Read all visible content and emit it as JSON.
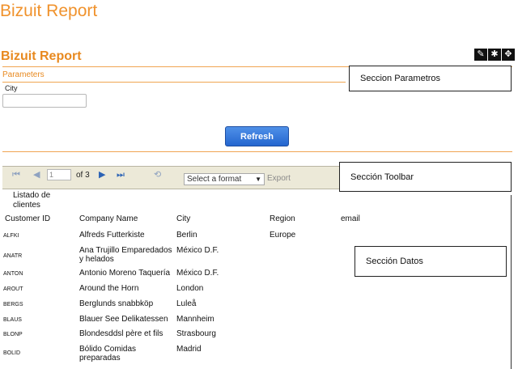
{
  "page_title": "Bizuit Report",
  "report_title": "Bizuit Report",
  "toolbar_icons": [
    "pencil-icon",
    "gear-icon",
    "move-icon"
  ],
  "parameters": {
    "section_label": "Parameters",
    "city_label": "City",
    "city_value": "",
    "refresh_label": "Refresh"
  },
  "callouts": {
    "params": "Seccion Parametros",
    "toolbar": "Sección Toolbar",
    "data": "Sección Datos"
  },
  "report_toolbar": {
    "page_value": "1",
    "page_of": "of 3",
    "format_placeholder": "Select a format",
    "export_label": "Export"
  },
  "data": {
    "list_title": "Listado de clientes",
    "columns": [
      "Customer ID",
      "Company Name",
      "City",
      "Region",
      "email"
    ],
    "rows": [
      {
        "id": "ALFKI",
        "company": "Alfreds Futterkiste",
        "city": "Berlin",
        "region": "Europe"
      },
      {
        "id": "ANATR",
        "company": "Ana Trujillo Emparedados y helados",
        "city": "México D.F.",
        "region": ""
      },
      {
        "id": "ANTON",
        "company": "Antonio Moreno Taquería",
        "city": "México D.F.",
        "region": ""
      },
      {
        "id": "AROUT",
        "company": "Around the Horn",
        "city": "London",
        "region": ""
      },
      {
        "id": "BERGS",
        "company": "Berglunds snabbköp",
        "city": "Luleå",
        "region": ""
      },
      {
        "id": "BLAUS",
        "company": "Blauer See Delikatessen",
        "city": "Mannheim",
        "region": ""
      },
      {
        "id": "BLONP",
        "company": "Blondesddsl père et fils",
        "city": "Strasbourg",
        "region": ""
      },
      {
        "id": "BOLID",
        "company": "Bólido Comidas preparadas",
        "city": "Madrid",
        "region": ""
      }
    ]
  }
}
